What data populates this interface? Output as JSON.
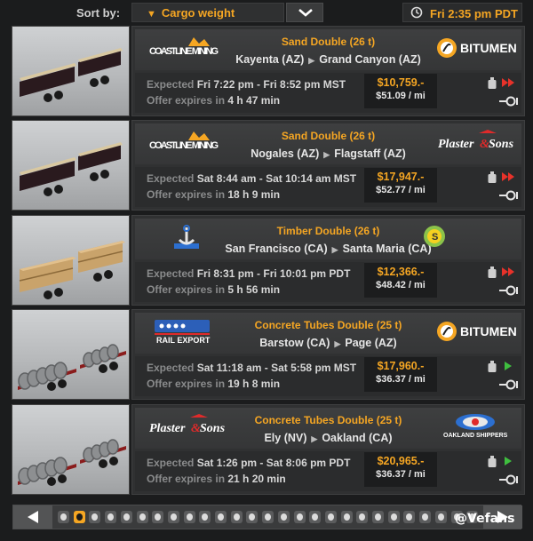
{
  "sort": {
    "label": "Sort by:",
    "selected": "Cargo weight"
  },
  "clock": {
    "time": "Fri 2:35 pm PDT"
  },
  "labels": {
    "expected": "Expected",
    "offer_expires": "Offer expires in",
    "route_sep": "▶"
  },
  "jobs": [
    {
      "source_company": "COASTLINE MINING",
      "dest_company": "BITUMEN",
      "cargo": "Sand Double (26 t)",
      "origin": "Kayenta (AZ)",
      "destination": "Grand Canyon (AZ)",
      "expected": "Fri 7:22 pm - Fri 8:52 pm MST",
      "expires": "4 h 47 min",
      "pay": "$10,759.-",
      "per_mile": "$51.09 / mi",
      "urgency": "high",
      "trailer": "sand"
    },
    {
      "source_company": "COASTLINE MINING",
      "dest_company": "Plaster&Sons",
      "cargo": "Sand Double (26 t)",
      "origin": "Nogales (AZ)",
      "destination": "Flagstaff (AZ)",
      "expected": "Sat 8:44 am - Sat 10:14 am MST",
      "expires": "18 h 9 min",
      "pay": "$17,947.-",
      "per_mile": "$52.77 / mi",
      "urgency": "high",
      "trailer": "sand"
    },
    {
      "source_company": "",
      "dest_company": "",
      "cargo": "Timber Double (26 t)",
      "origin": "San Francisco (CA)",
      "destination": "Santa Maria (CA)",
      "expected": "Fri 8:31 pm - Fri 10:01 pm PDT",
      "expires": "5 h 56 min",
      "pay": "$12,366.-",
      "per_mile": "$48.42 / mi",
      "urgency": "high",
      "trailer": "timber"
    },
    {
      "source_company": "RAIL EXPORT",
      "dest_company": "BITUMEN",
      "cargo": "Concrete Tubes Double (25 t)",
      "origin": "Barstow (CA)",
      "destination": "Page (AZ)",
      "expected": "Sat 11:18 am - Sat 5:58 pm MST",
      "expires": "19 h 8 min",
      "pay": "$17,960.-",
      "per_mile": "$36.37 / mi",
      "urgency": "normal",
      "trailer": "tubes"
    },
    {
      "source_company": "Plaster&Sons",
      "dest_company": "OAKLAND SHIPPERS",
      "cargo": "Concrete Tubes Double (25 t)",
      "origin": "Ely (NV)",
      "destination": "Oakland (CA)",
      "expected": "Sat 1:26 pm - Sat 8:06 pm PDT",
      "expires": "21 h 20 min",
      "pay": "$20,965.-",
      "per_mile": "$36.37 / mi",
      "urgency": "normal",
      "trailer": "tubes"
    }
  ],
  "pager": {
    "pages": 27,
    "active_index": 1
  },
  "watermark": "@Vefans",
  "colors": {
    "accent": "#f5a623",
    "urgent": "#e8322a",
    "normal": "#3fbf3f"
  }
}
